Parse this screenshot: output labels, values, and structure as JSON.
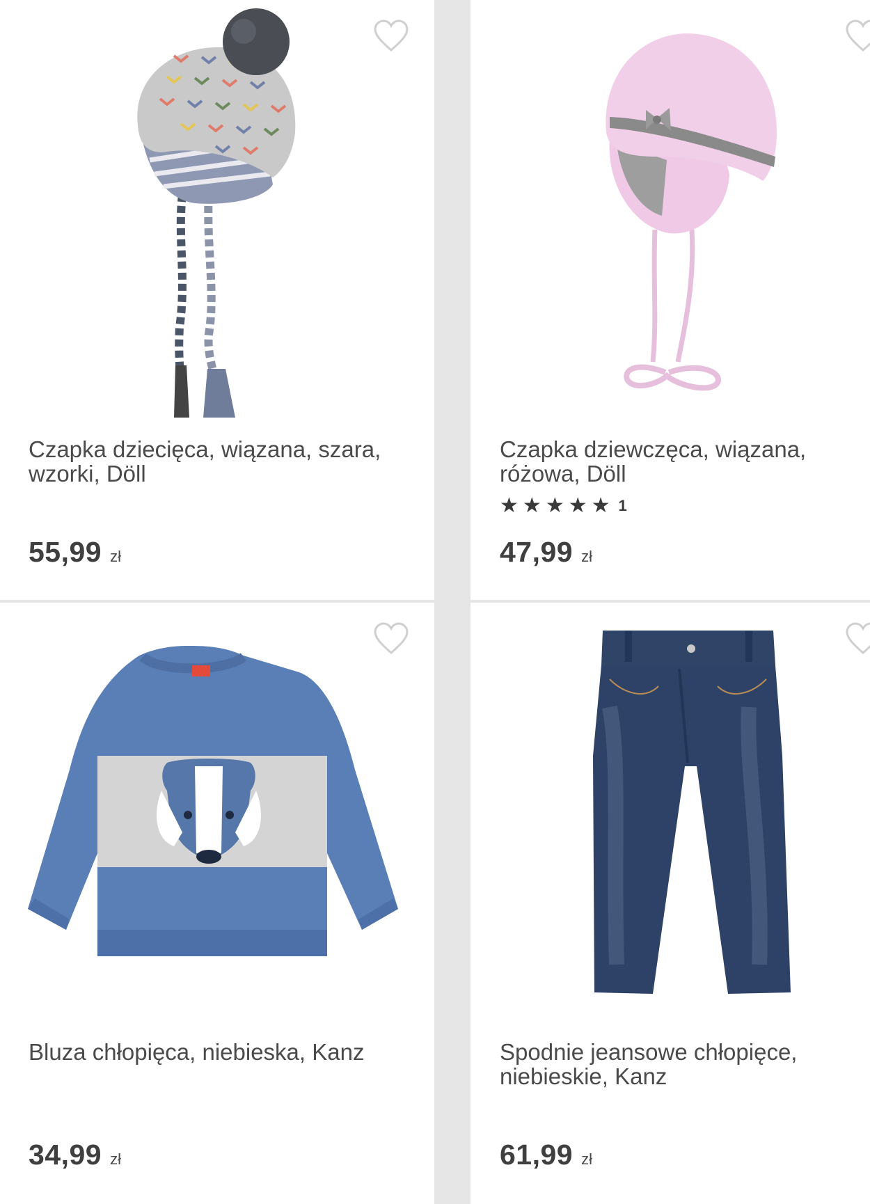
{
  "products": [
    {
      "title": "Czapka dziecięca, wiązana, szara, wzorki, Döll",
      "price": "55,99",
      "currency": "zł",
      "icon": "heart-outline-icon"
    },
    {
      "title": "Czapka dziewczęca, wiązana, różowa, Döll",
      "rating_count": "1",
      "stars": 5,
      "price": "47,99",
      "currency": "zł",
      "icon": "heart-outline-icon"
    },
    {
      "title": "Bluza chłopięca, niebieska, Kanz",
      "price": "34,99",
      "currency": "zł",
      "icon": "heart-outline-icon"
    },
    {
      "title": "Spodnie jeansowe chłopięce, niebieskie, Kanz",
      "price": "61,99",
      "currency": "zł",
      "icon": "heart-outline-icon"
    }
  ],
  "colors": {
    "background": "#e6e6e6",
    "card": "#ffffff",
    "text": "#404040",
    "heart": "#cfcfcf"
  }
}
